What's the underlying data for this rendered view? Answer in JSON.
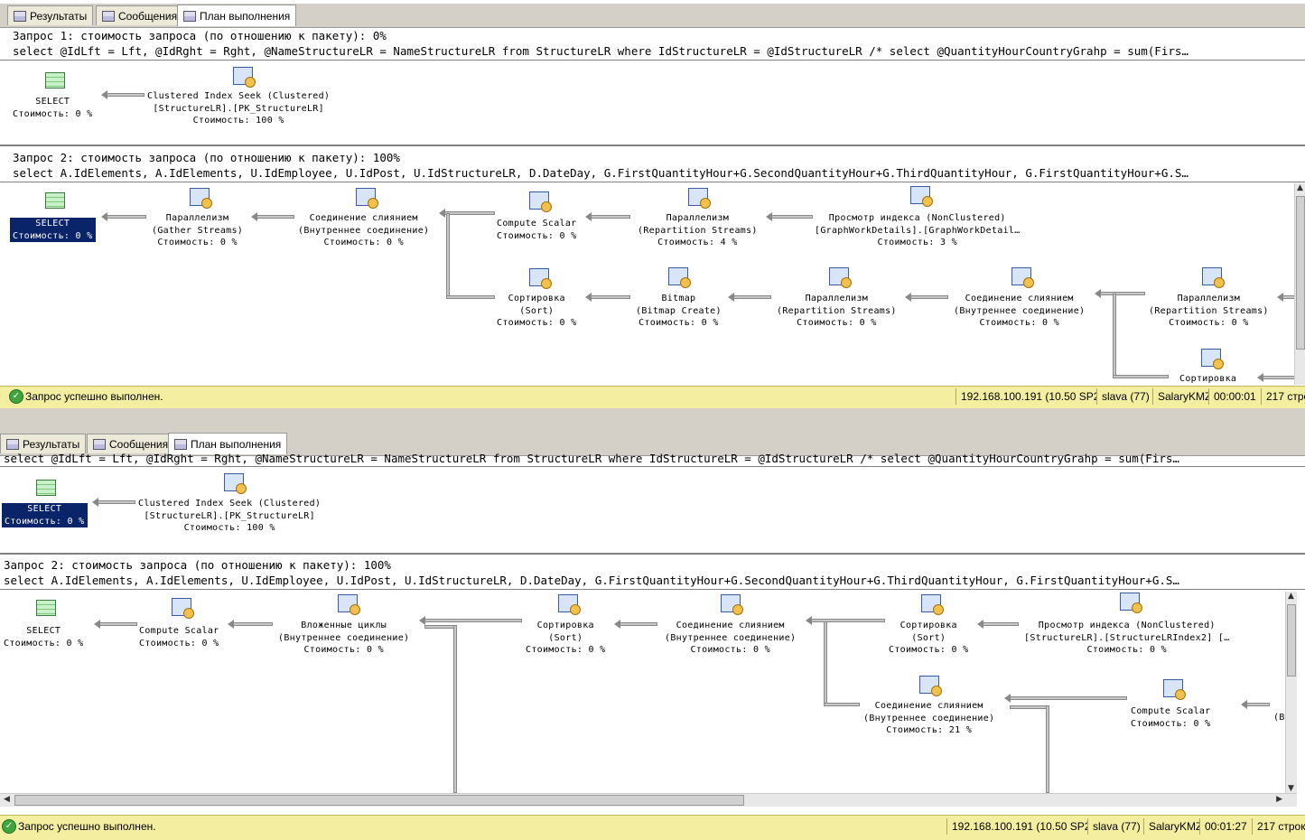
{
  "top": {
    "tabs": [
      {
        "label": "Результаты"
      },
      {
        "label": "Сообщения"
      },
      {
        "label": "План выполнения"
      }
    ],
    "q1": {
      "header": "Запрос 1: стоимость запроса (по отношению к пакету): 0%",
      "sql": "select @IdLft = Lft, @IdRght = Rght, @NameStructureLR = NameStructureLR from StructureLR where IdStructureLR = @IdStructureLR /* select @QuantityHourCountryGrahp = sum(Firs…",
      "select": {
        "l1": "SELECT",
        "l2": "Стоимость: 0 %"
      },
      "seek": {
        "l1": "Clustered Index Seek (Clustered)",
        "l2": "[StructureLR].[PK_StructureLR]",
        "l3": "Стоимость: 100 %"
      }
    },
    "q2": {
      "header": "Запрос 2: стоимость запроса (по отношению к пакету): 100%",
      "sql": "select A.IdElements, A.IdElements, U.IdEmployee, U.IdPost, U.IdStructureLR, D.DateDay, G.FirstQuantityHour+G.SecondQuantityHour+G.ThirdQuantityHour, G.FirstQuantityHour+G.S…",
      "nodes": [
        {
          "l1": "SELECT",
          "l2": "Стоимость: 0 %"
        },
        {
          "l1": "Параллелизм",
          "l2": "(Gather Streams)",
          "l3": "Стоимость: 0 %"
        },
        {
          "l1": "Соединение слиянием",
          "l2": "(Внутреннее соединение)",
          "l3": "Стоимость: 0 %"
        },
        {
          "l1": "Compute Scalar",
          "l2": "Стоимость: 0 %"
        },
        {
          "l1": "Параллелизм",
          "l2": "(Repartition Streams)",
          "l3": "Стоимость: 4 %"
        },
        {
          "l1": "Просмотр индекса (NonClustered)",
          "l2": "[GraphWorkDetails].[GraphWorkDetail…",
          "l3": "Стоимость: 3 %"
        },
        {
          "l1": "Сортировка",
          "l2": "(Sort)",
          "l3": "Стоимость: 0 %"
        },
        {
          "l1": "Bitmap",
          "l2": "(Bitmap Create)",
          "l3": "Стоимость: 0 %"
        },
        {
          "l1": "Параллелизм",
          "l2": "(Repartition Streams)",
          "l3": "Стоимость: 0 %"
        },
        {
          "l1": "Соединение слиянием",
          "l2": "(Внутреннее соединение)",
          "l3": "Стоимость: 0 %"
        },
        {
          "l1": "Параллелизм",
          "l2": "(Repartition Streams)",
          "l3": "Стоимость: 0 %"
        },
        {
          "l1": "Сортировка"
        }
      ]
    },
    "status": {
      "msg": "Запрос успешно выполнен.",
      "server": "192.168.100.191 (10.50 SP2)",
      "user": "slava (77)",
      "db": "SalaryKMZ",
      "time": "00:00:01",
      "rows": "217 стро"
    }
  },
  "bottom": {
    "tabs": [
      {
        "label": "Результаты"
      },
      {
        "label": "Сообщения"
      },
      {
        "label": "План выполнения"
      }
    ],
    "q1": {
      "sql": "select @IdLft = Lft, @IdRght = Rght, @NameStructureLR = NameStructureLR from StructureLR where IdStructureLR = @IdStructureLR /* select @QuantityHourCountryGrahp = sum(Firs…",
      "select": {
        "l1": "SELECT",
        "l2": "Стоимость: 0 %"
      },
      "seek": {
        "l1": "Clustered Index Seek (Clustered)",
        "l2": "[StructureLR].[PK_StructureLR]",
        "l3": "Стоимость: 100 %"
      }
    },
    "q2": {
      "header": "Запрос 2: стоимость запроса (по отношению к пакету): 100%",
      "sql": "select A.IdElements, A.IdElements, U.IdEmployee, U.IdPost, U.IdStructureLR, D.DateDay, G.FirstQuantityHour+G.SecondQuantityHour+G.ThirdQuantityHour, G.FirstQuantityHour+G.S…",
      "nodes": [
        {
          "l1": "SELECT",
          "l2": "Стоимость: 0 %"
        },
        {
          "l1": "Compute Scalar",
          "l2": "Стоимость: 0 %"
        },
        {
          "l1": "Вложенные циклы",
          "l2": "(Внутреннее соединение)",
          "l3": "Стоимость: 0 %"
        },
        {
          "l1": "Сортировка",
          "l2": "(Sort)",
          "l3": "Стоимость: 0 %"
        },
        {
          "l1": "Соединение слиянием",
          "l2": "(Внутреннее соединение)",
          "l3": "Стоимость: 0 %"
        },
        {
          "l1": "Сортировка",
          "l2": "(Sort)",
          "l3": "Стоимость: 0 %"
        },
        {
          "l1": "Просмотр индекса (NonClustered)",
          "l2": "[StructureLR].[StructureLRIndex2] […",
          "l3": "Стоимость: 0 %"
        },
        {
          "l1": "Соединение слиянием",
          "l2": "(Внутреннее соединение)",
          "l3": "Стоимость: 21 %"
        },
        {
          "l1": "Compute Scalar",
          "l2": "Стоимость: 0 %"
        },
        {
          "l1": "(B"
        }
      ]
    },
    "status": {
      "msg": "Запрос успешно выполнен.",
      "server": "192.168.100.191 (10.50 SP2)",
      "user": "slava (77)",
      "db": "SalaryKMZ",
      "time": "00:01:27",
      "rows": "217 строк"
    }
  }
}
